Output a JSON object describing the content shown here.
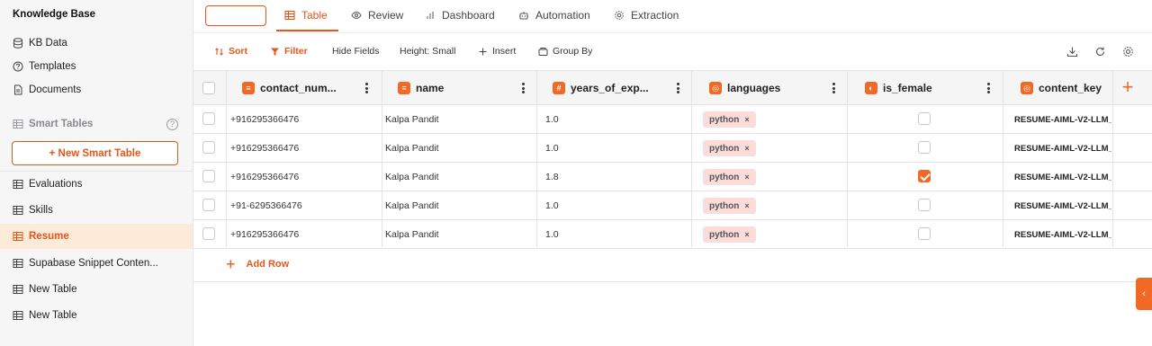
{
  "sidebar": {
    "title": "Knowledge Base",
    "items_top": [
      {
        "label": "KB Data",
        "icon": "database-icon"
      },
      {
        "label": "Templates",
        "icon": "help-circle-icon"
      },
      {
        "label": "Documents",
        "icon": "document-icon"
      }
    ],
    "section_label": "Smart Tables",
    "section_help": "?",
    "new_button": "+ New Smart Table",
    "tables": [
      {
        "label": "Evaluations",
        "active": false
      },
      {
        "label": "Skills",
        "active": false
      },
      {
        "label": "Resume",
        "active": true
      },
      {
        "label": "Supabase Snippet Conten...",
        "active": false
      },
      {
        "label": "New Table",
        "active": false
      },
      {
        "label": "New Table",
        "active": false
      }
    ]
  },
  "tabs": [
    {
      "label": "Table",
      "icon": "table-icon",
      "active": true
    },
    {
      "label": "Review",
      "icon": "eye-icon",
      "active": false
    },
    {
      "label": "Dashboard",
      "icon": "bar-chart-icon",
      "active": false
    },
    {
      "label": "Automation",
      "icon": "robot-icon",
      "active": false
    },
    {
      "label": "Extraction",
      "icon": "gear-icon",
      "active": false
    }
  ],
  "toolbar": {
    "sort": "Sort",
    "filter": "Filter",
    "hide_fields": "Hide Fields",
    "height": "Height: Small",
    "insert": "Insert",
    "group_by": "Group By"
  },
  "columns": [
    {
      "label": "contact_num...",
      "type": "text"
    },
    {
      "label": "name",
      "type": "text"
    },
    {
      "label": "years_of_exp...",
      "type": "number",
      "type_glyph": "#"
    },
    {
      "label": "languages",
      "type": "tags"
    },
    {
      "label": "is_female",
      "type": "toggle"
    },
    {
      "label": "content_key",
      "type": "tags"
    }
  ],
  "rows": [
    {
      "contact": "+916295366476",
      "name": "Kalpa Pandit",
      "years": "1.0",
      "language": "python",
      "is_female": false,
      "content_key": "RESUME-AIML-V2-LLM_"
    },
    {
      "contact": "+916295366476",
      "name": "Kalpa Pandit",
      "years": "1.0",
      "language": "python",
      "is_female": false,
      "content_key": "RESUME-AIML-V2-LLM_"
    },
    {
      "contact": "+916295366476",
      "name": "Kalpa Pandit",
      "years": "1.8",
      "language": "python",
      "is_female": true,
      "content_key": "RESUME-AIML-V2-LLM_"
    },
    {
      "contact": "+91-6295366476",
      "name": "Kalpa Pandit",
      "years": "1.0",
      "language": "python",
      "is_female": false,
      "content_key": "RESUME-AIML-V2-LLM_"
    },
    {
      "contact": "+916295366476",
      "name": "Kalpa Pandit",
      "years": "1.0",
      "language": "python",
      "is_female": false,
      "content_key": "RESUME-AIML-V2-LLM_"
    }
  ],
  "chip_remove": "×",
  "add_row": "Add Row",
  "colors": {
    "accent": "#e4571b",
    "accent_light": "#fdebd9",
    "chip_bg": "#fbdcd8"
  }
}
